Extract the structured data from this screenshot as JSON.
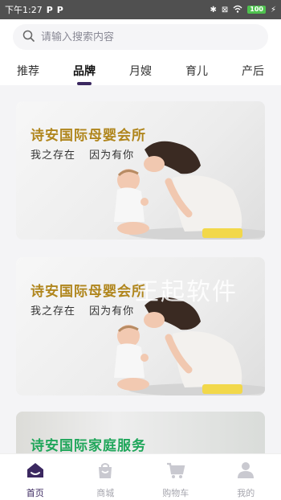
{
  "status_bar": {
    "time": "下午1:27",
    "notif_icons": [
      "P",
      "P"
    ],
    "battery": "100"
  },
  "search": {
    "placeholder": "请输入搜索内容"
  },
  "tabs": [
    {
      "label": "推荐"
    },
    {
      "label": "品牌",
      "active": true
    },
    {
      "label": "月嫂"
    },
    {
      "label": "育儿"
    },
    {
      "label": "产后"
    }
  ],
  "cards": [
    {
      "title": "诗安国际母婴会所",
      "subtitle_a": "我之存在",
      "subtitle_b": "因为有你"
    },
    {
      "title": "诗安国际母婴会所",
      "subtitle_a": "我之存在",
      "subtitle_b": "因为有你"
    },
    {
      "title": "诗安国际家庭服务"
    }
  ],
  "watermark": "王起软件",
  "bottom_nav": [
    {
      "label": "首页",
      "icon": "home-icon",
      "active": true
    },
    {
      "label": "商城",
      "icon": "bag-icon"
    },
    {
      "label": "购物车",
      "icon": "cart-icon"
    },
    {
      "label": "我的",
      "icon": "user-icon"
    }
  ],
  "colors": {
    "accent": "#3b2860",
    "brand_gold": "#b0861d",
    "brand_green": "#1fa65a",
    "inactive": "#a6a6ae"
  }
}
